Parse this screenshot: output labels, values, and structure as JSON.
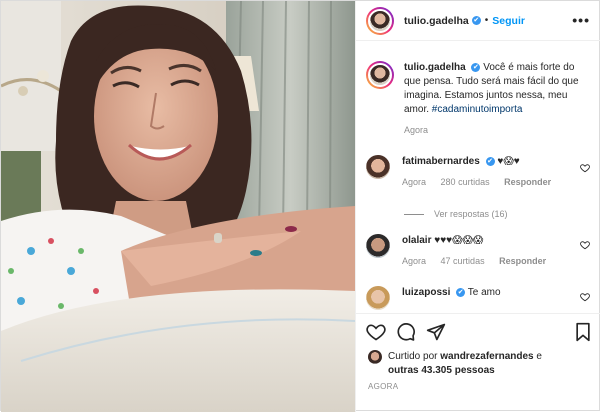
{
  "header": {
    "username": "tulio.gadelha",
    "verified_mark": "✔",
    "separator": "•",
    "follow_label": "Seguir",
    "more_label": "•••"
  },
  "caption": {
    "username": "tulio.gadelha",
    "text": "Você é mais forte do que pensa. Tudo será mais fácil do que imagina. Estamos juntos nessa, meu amor.",
    "hashtag": "#cadaminutoimporta",
    "time": "Agora"
  },
  "comments": [
    {
      "username": "fatimabernardes",
      "verified": true,
      "text": "♥😱♥",
      "time": "Agora",
      "likes": "280 curtidas",
      "reply_label": "Responder",
      "view_replies": "Ver respostas (16)"
    },
    {
      "username": "olalair",
      "verified": false,
      "text": "♥♥♥😱😱😱",
      "time": "Agora",
      "likes": "47 curtidas",
      "reply_label": "Responder"
    },
    {
      "username": "luizapossi",
      "verified": true,
      "text": "Te amo"
    }
  ],
  "actions": {
    "icons": [
      "heart-icon",
      "comment-icon",
      "share-icon",
      "bookmark-icon"
    ]
  },
  "likes": {
    "prefix": "Curtido por",
    "user": "wandrezafernandes",
    "middle": "e",
    "others": "outras 43.305 pessoas"
  },
  "timestamp": "AGORA",
  "colors": {
    "accent": "#0095f6",
    "verified": "#3897f0",
    "muted": "#8e8e8e",
    "hashtag": "#00376b"
  }
}
